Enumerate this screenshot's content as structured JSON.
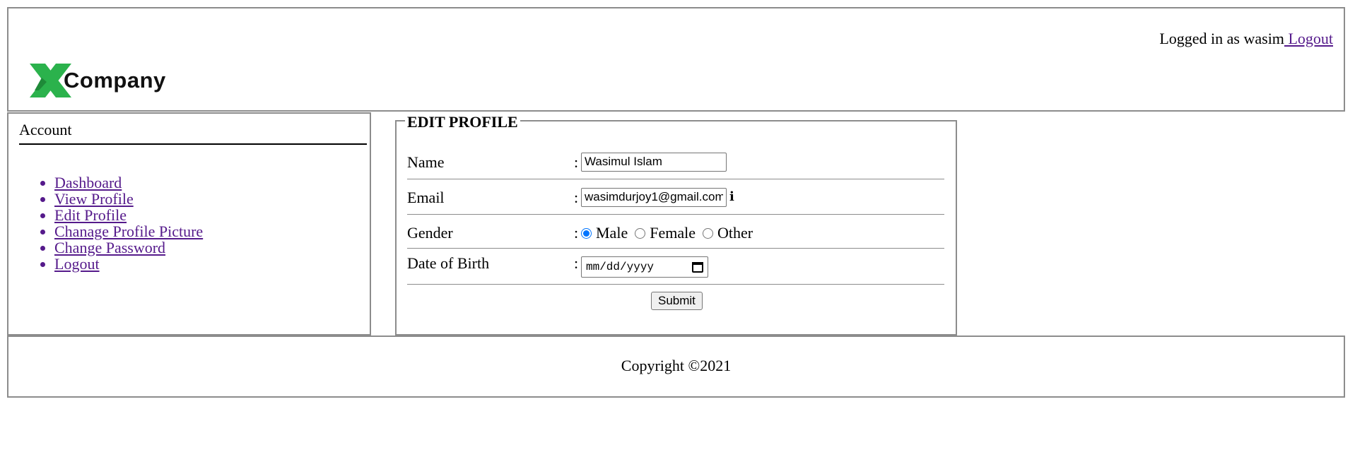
{
  "header": {
    "logo_letter": "X",
    "logo_text": "Company",
    "logged_in_text": "Logged in as wasim",
    "logout_link": " Logout"
  },
  "sidebar": {
    "title": "Account",
    "items": [
      {
        "label": "Dashboard"
      },
      {
        "label": "View Profile"
      },
      {
        "label": "Edit Profile"
      },
      {
        "label": "Chanage Profile Picture"
      },
      {
        "label": "Change Password"
      },
      {
        "label": "Logout"
      }
    ]
  },
  "form": {
    "legend": "EDIT PROFILE",
    "colon": ":",
    "name": {
      "label": "Name",
      "value": "Wasimul Islam"
    },
    "email": {
      "label": "Email",
      "value": "wasimdurjoy1@gmail.com",
      "info_icon": "i"
    },
    "gender": {
      "label": "Gender",
      "selected": "Male",
      "options": [
        "Male",
        "Female",
        "Other"
      ]
    },
    "dob": {
      "label": "Date of Birth",
      "placeholder": "mm/dd/yyyy"
    },
    "submit_label": "Submit"
  },
  "footer": {
    "copyright": "Copyright ©2021"
  },
  "colors": {
    "logo_green": "#2bb24c",
    "link": "#551a8b",
    "border": "#8c8c8c"
  },
  "icons": {
    "email_info": "info-icon",
    "date_picker": "calendar-icon"
  }
}
